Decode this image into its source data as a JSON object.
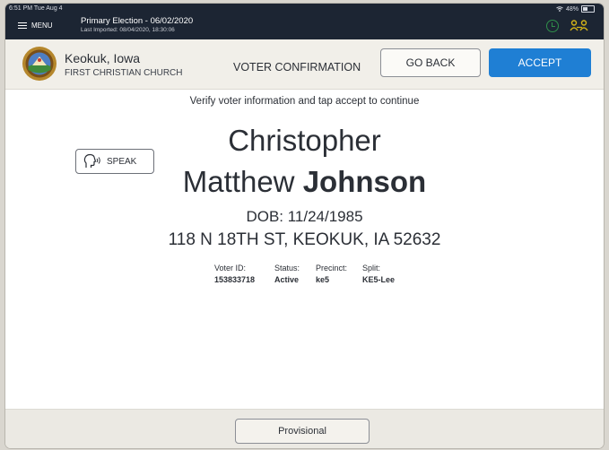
{
  "status_bar": {
    "time": "6:51 PM",
    "date": "Tue Aug 4",
    "battery": "48%"
  },
  "topbar": {
    "menu_label": "MENU",
    "election_title": "Primary Election - 06/02/2020",
    "last_imported": "Last Imported: 08/04/2020, 18:30:06"
  },
  "header": {
    "location_name": "Keokuk, Iowa",
    "location_place": "FIRST CHRISTIAN CHURCH",
    "screen_title": "VOTER CONFIRMATION",
    "back_label": "GO BACK",
    "accept_label": "ACCEPT"
  },
  "main": {
    "instruction": "Verify voter information and tap accept to continue",
    "speak_label": "SPEAK",
    "first_line": "Christopher",
    "middle_name": "Matthew",
    "last_name": "Johnson",
    "dob": "DOB: 11/24/1985",
    "address": "118 N 18TH ST, KEOKUK, IA 52632",
    "fields": [
      {
        "label": "Voter ID:",
        "value": "153833718"
      },
      {
        "label": "Status:",
        "value": "Active"
      },
      {
        "label": "Precinct:",
        "value": "ke5"
      },
      {
        "label": "Split:",
        "value": "KE5-Lee"
      }
    ]
  },
  "footer": {
    "provisional_label": "Provisional"
  },
  "colors": {
    "topbar": "#1c2533",
    "accent": "#1f7fd4",
    "status_icon": "#2f8f4a",
    "people_icon": "#d4b418"
  },
  "icons": [
    "menu-icon",
    "wifi-icon",
    "battery-icon",
    "clock-icon",
    "people-icon",
    "county-seal",
    "speak-icon"
  ]
}
